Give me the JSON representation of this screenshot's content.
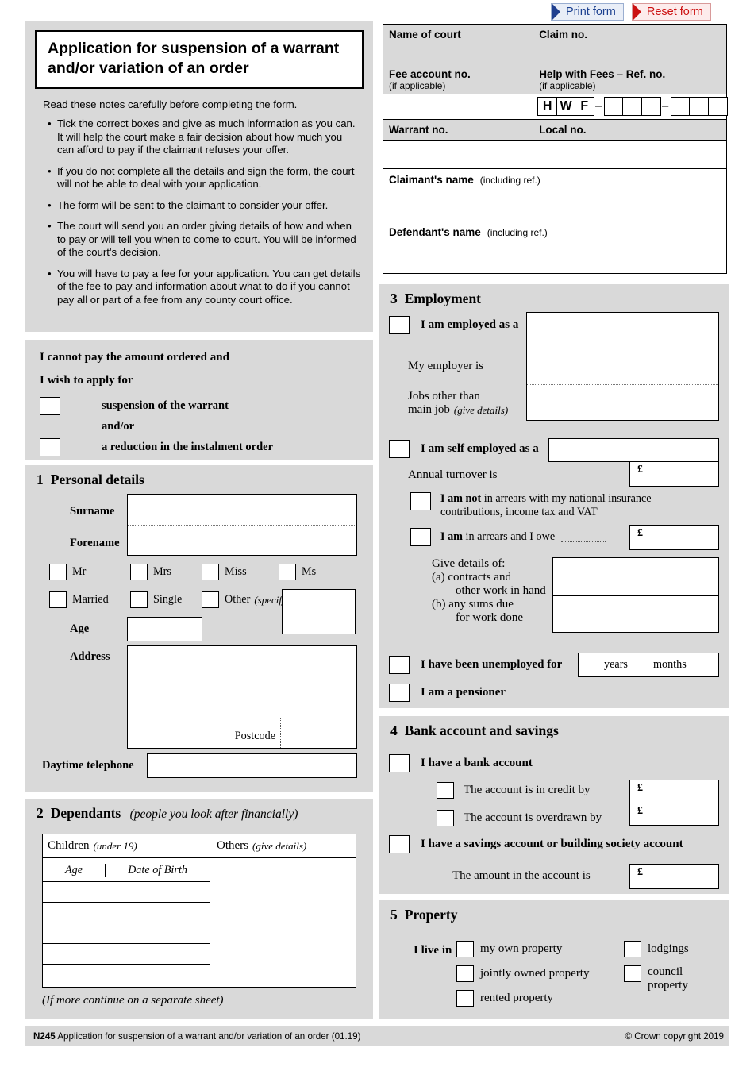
{
  "toolbar": {
    "print_label": "Print form",
    "reset_label": "Reset form"
  },
  "header": {
    "title": "Application for suspension of a warrant and/or variation of an order",
    "intro": "Read these notes carefully before completing the form.",
    "notes": [
      "Tick the correct boxes and give as much information as you can. It will help the court make a fair decision about how much you can afford to pay if the claimant refuses your offer.",
      "If you do not complete all the details and sign the form, the court will not be able to deal with your application.",
      "The form will be sent to the claimant to consider your offer.",
      "The court will send you an order giving details of how and when to pay or will tell you when to come to court. You will be informed of the court's decision.",
      "You will have to pay a fee for your application. You can get details of the fee to pay and information about what to do if you cannot pay all or part of a fee from any county court office."
    ]
  },
  "court_table": {
    "name_of_court": "Name of court",
    "claim_no": "Claim no.",
    "fee_account_no": "Fee account no.",
    "fee_account_sub": "(if applicable)",
    "help_with_fees": "Help with Fees – Ref. no.",
    "help_with_fees_sub": "(if applicable)",
    "hwf_prefix": [
      "H",
      "W",
      "F"
    ],
    "hwf_dash": "–",
    "warrant_no": "Warrant no.",
    "local_no": "Local no.",
    "claimant_name": "Claimant's name",
    "claimant_name_sub": "(including ref.)",
    "defendant_name": "Defendant's name",
    "defendant_name_sub": "(including ref.)",
    "name_of_court_value": "",
    "claim_no_value": "",
    "fee_account_value": "",
    "warrant_no_value": "",
    "local_no_value": "",
    "claimant_value": "",
    "defendant_value": ""
  },
  "apply": {
    "line1": "I cannot pay the amount ordered and",
    "line2": "I wish to apply for",
    "option1": "suspension of the warrant",
    "andor": "and/or",
    "option2": "a reduction in the instalment order"
  },
  "personal": {
    "num": "1",
    "heading": "Personal details",
    "surname_label": "Surname",
    "forename_label": "Forename",
    "surname_value": "",
    "forename_value": "",
    "titles": [
      "Mr",
      "Mrs",
      "Miss",
      "Ms"
    ],
    "status": [
      "Married",
      "Single",
      "Other"
    ],
    "other_specify": "(specify)",
    "other_value": "",
    "age_label": "Age",
    "age_value": "",
    "address_label": "Address",
    "address_value": "",
    "postcode_label": "Postcode",
    "postcode_value": "",
    "telephone_label": "Daytime telephone",
    "telephone_value": ""
  },
  "dependants": {
    "num": "2",
    "heading": "Dependants",
    "heading_sub": "(people you look after financially)",
    "children_label": "Children",
    "children_sub": "(under 19)",
    "others_label": "Others",
    "others_sub": "(give details)",
    "col_age": "Age",
    "col_dob": "Date of Birth",
    "rows": [
      {
        "age": "",
        "dob": ""
      },
      {
        "age": "",
        "dob": ""
      },
      {
        "age": "",
        "dob": ""
      },
      {
        "age": "",
        "dob": ""
      },
      {
        "age": "",
        "dob": ""
      }
    ],
    "others_value": "",
    "footnote": "(If more continue on a separate sheet)"
  },
  "employment": {
    "num": "3",
    "heading": "Employment",
    "employed_label": "I am employed as a",
    "employed_value": "",
    "employer_label": "My employer is",
    "employer_value": "",
    "other_jobs_label_1": "Jobs other than",
    "other_jobs_label_2": "main job",
    "other_jobs_sub": "(give details)",
    "other_jobs_value": "",
    "self_employed_label": "I am self employed as a",
    "self_employed_value": "",
    "turnover_label": "Annual turnover is",
    "turnover_currency": "£",
    "turnover_value": "",
    "not_arrears_bold": "I am not",
    "not_arrears_rest_1": "in arrears with my national insurance",
    "not_arrears_rest_2": "contributions, income tax and VAT",
    "arrears_bold": "I am",
    "arrears_rest": "in arrears and I owe",
    "arrears_currency": "£",
    "arrears_value": "",
    "give_details": "Give details of:",
    "detail_a_1": "(a)  contracts and",
    "detail_a_2": "other work in hand",
    "detail_b_1": "(b)  any sums due",
    "detail_b_2": "for work done",
    "detail_a_value": "",
    "detail_b_value": "",
    "unemployed_label": "I have been unemployed for",
    "unemployed_years": "years",
    "unemployed_months": "months",
    "unemployed_years_value": "",
    "unemployed_months_value": "",
    "pensioner_label": "I am a pensioner"
  },
  "bank": {
    "num": "4",
    "heading": "Bank account and savings",
    "have_account_label": "I have a bank account",
    "credit_label": "The account is in credit by",
    "overdrawn_label": "The account is overdrawn by",
    "credit_currency": "£",
    "overdrawn_currency": "£",
    "credit_value": "",
    "overdrawn_value": "",
    "savings_label": "I have a savings account or building society account",
    "amount_label": "The amount in the account is",
    "amount_currency": "£",
    "amount_value": ""
  },
  "property": {
    "num": "5",
    "heading": "Property",
    "live_in_label": "I live in",
    "left_options": [
      "my own property",
      "jointly owned property",
      "rented property"
    ],
    "right_options": [
      "lodgings",
      "council property"
    ],
    "right_option_2_line1": "council",
    "right_option_2_line2": "property"
  },
  "footer": {
    "form_code": "N245",
    "form_title": "Application for suspension of a warrant and/or variation of an order (01.19)",
    "copyright": "© Crown copyright 2019"
  },
  "colors": {
    "panel_bg": "#d9d9d9",
    "print_accent": "#1f3f8f",
    "reset_accent": "#cc1111"
  }
}
